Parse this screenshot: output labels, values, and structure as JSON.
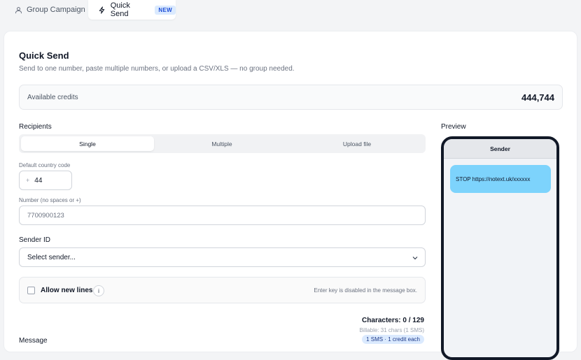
{
  "tabs": [
    {
      "label": "Group Campaign",
      "icon": "users-icon"
    },
    {
      "label": "Quick Send",
      "icon": "lightning-icon",
      "badge": "NEW"
    }
  ],
  "header": {
    "title": "Quick Send",
    "subtitle": "Send to one number, paste multiple numbers, or upload a CSV/XLS — no group needed."
  },
  "credits": {
    "label": "Available credits",
    "value": "444,744"
  },
  "recipients": {
    "label": "Recipients",
    "options": [
      "Single",
      "Multiple",
      "Upload file"
    ],
    "selected": "Single"
  },
  "country_code": {
    "label": "Default country code",
    "prefix": "+",
    "value": "44"
  },
  "number": {
    "label": "Number (no spaces or +)",
    "placeholder": "7700900123"
  },
  "sender": {
    "label": "Sender ID",
    "placeholder": "Select sender..."
  },
  "newlines": {
    "label": "Allow new lines",
    "info": "i",
    "hint": "Enter key is disabled in the message box."
  },
  "message": {
    "label": "Message",
    "characters": "Characters: 0 / 129",
    "billable": "Billable: 31 chars (1 SMS)",
    "sms_badge": "1 SMS · 1 credit each"
  },
  "preview": {
    "label": "Preview",
    "sender": "Sender",
    "bubble": "STOP https://notext.uk/xxxxxx"
  },
  "colors": {
    "accent": "#1d4ed8",
    "bubble": "#7dd3fc",
    "phone_frame": "#111827"
  }
}
